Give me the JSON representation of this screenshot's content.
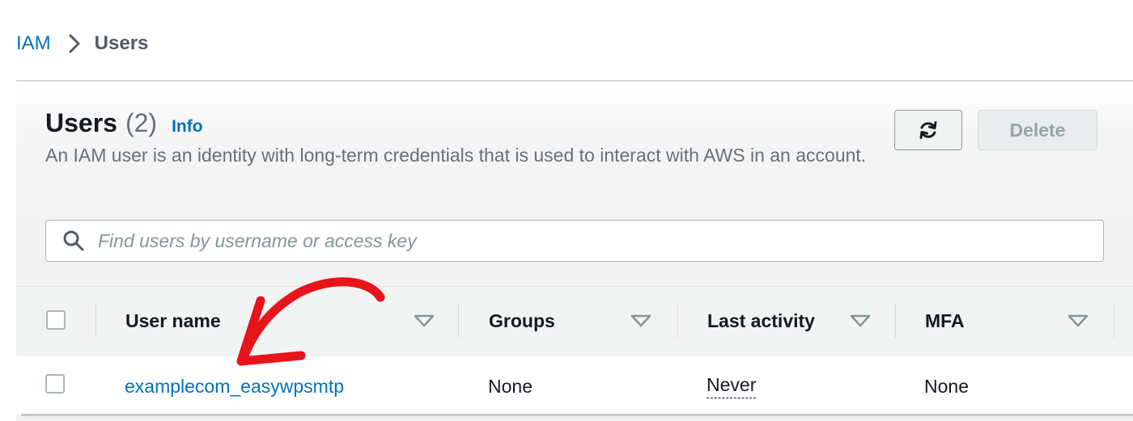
{
  "breadcrumb": {
    "parent": "IAM",
    "current": "Users"
  },
  "header": {
    "title": "Users",
    "count": "(2)",
    "info": "Info",
    "description": "An IAM user is an identity with long-term credentials that is used to interact with AWS in an account."
  },
  "buttons": {
    "refresh_icon": "refresh-icon",
    "delete": "Delete"
  },
  "search": {
    "placeholder": "Find users by username or access key",
    "value": ""
  },
  "table": {
    "columns": [
      "User name",
      "Groups",
      "Last activity",
      "MFA"
    ],
    "rows": [
      {
        "user_name": "examplecom_easywpsmtp",
        "groups": "None",
        "last_activity": "Never",
        "mfa": "None"
      }
    ]
  },
  "colors": {
    "link": "#0073bb",
    "annotation_arrow": "#e8141c"
  }
}
